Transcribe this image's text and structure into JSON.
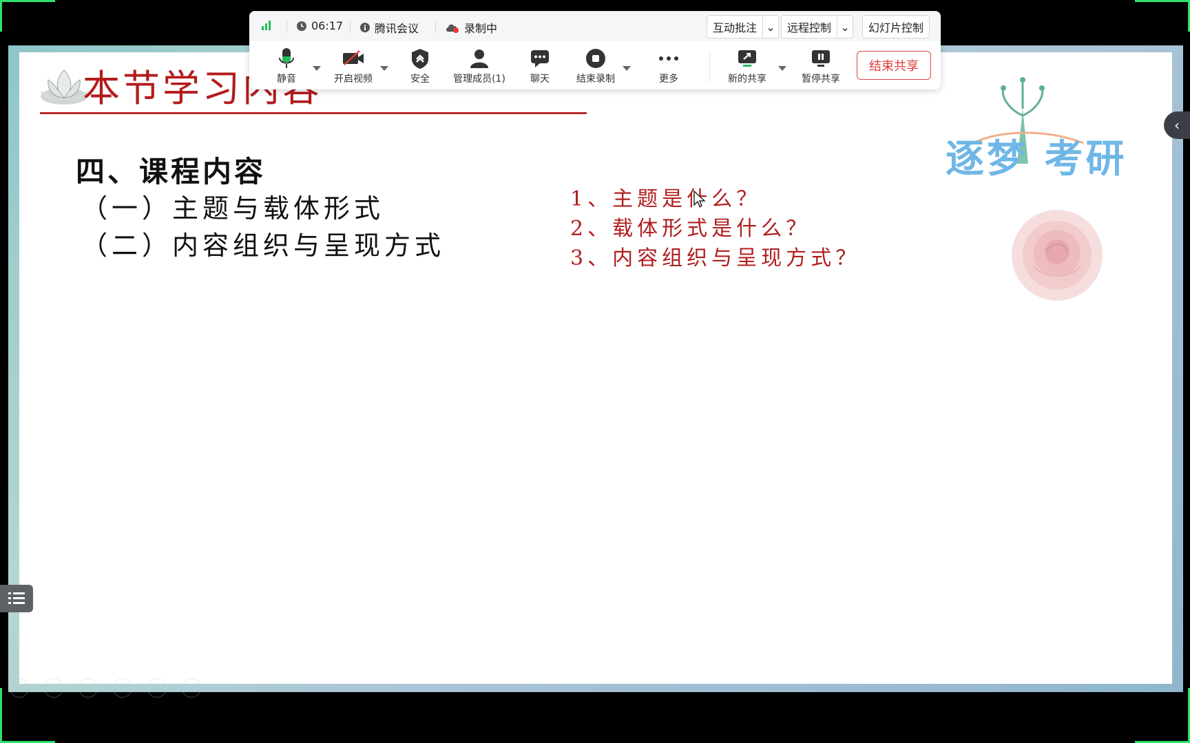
{
  "toolbar": {
    "status": {
      "time": "06:17",
      "meeting_name": "腾讯会议",
      "recording": "录制中"
    },
    "top_buttons": {
      "annotate": "互动批注",
      "remote_control": "远程控制",
      "slide_control": "幻灯片控制"
    },
    "tools": {
      "mute": "静音",
      "video": "开启视频",
      "security": "安全",
      "members": "管理成员(1)",
      "chat": "聊天",
      "stop_record": "结束录制",
      "more": "更多",
      "new_share": "新的共享",
      "pause_share": "暂停共享"
    },
    "end_share": "结束共享"
  },
  "slide": {
    "title": "本节学习内容",
    "heading": "四、课程内容",
    "subitems": [
      "（一）主题与载体形式",
      "（二）内容组织与呈现方式"
    ],
    "questions": [
      "1、主题是什么？",
      "2、载体形式是什么？",
      "3、内容组织与呈现方式？"
    ],
    "brand": "逐梦 考研"
  },
  "colors": {
    "title_red": "#b31b1b",
    "question_red": "#b01e1e",
    "accent_green": "#1fbf5a",
    "end_share_red": "#e03a3a",
    "brand_blue": "#6fb7e6"
  },
  "icons": {
    "signal": "signal-strength-icon",
    "clock": "clock-icon",
    "info": "info-icon",
    "cloud_record": "cloud-record-icon",
    "mic": "microphone-icon",
    "video_off": "video-off-icon",
    "shield": "shield-icon",
    "user": "user-icon",
    "chat": "chat-bubble-icon",
    "stop": "stop-circle-icon",
    "more": "more-dots-icon",
    "share": "share-screen-icon",
    "pause": "pause-icon",
    "list": "list-icon",
    "chevron_left": "chevron-left-icon"
  }
}
